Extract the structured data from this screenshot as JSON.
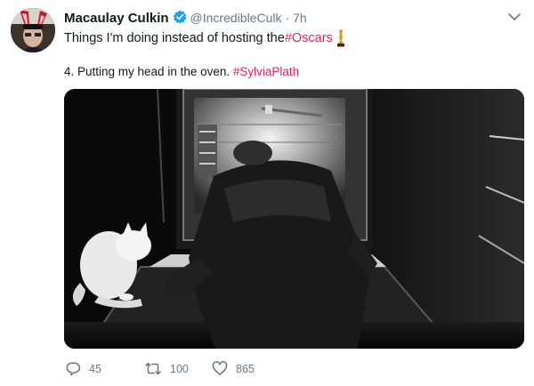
{
  "tweet": {
    "display_name": "Macaulay Culkin",
    "handle": "@IncredibleCulk",
    "separator": "·",
    "time": "7h",
    "verified_icon": "verified-badge-icon",
    "line1_text": "Things I'm doing instead of hosting the ",
    "line1_hashtag": "#Oscars",
    "line1_icon": "oscar-statuette-emoji",
    "line2_text": "4. Putting my head in the oven. ",
    "line2_hashtag": "#SylviaPlath",
    "more_icon": "chevron-down-icon",
    "hashtag_color": "#e0245e",
    "verified_color": "#1da1f2"
  },
  "actions": {
    "reply": {
      "icon": "reply-icon",
      "count": "45"
    },
    "retweet": {
      "icon": "retweet-icon",
      "count": "100"
    },
    "like": {
      "icon": "heart-icon",
      "count": "865"
    }
  }
}
